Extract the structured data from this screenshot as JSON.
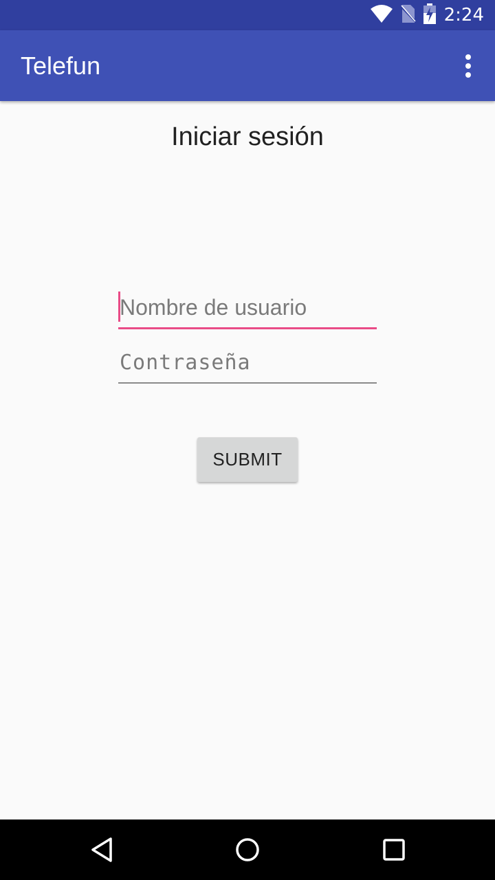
{
  "status_bar": {
    "time": "2:24",
    "icons": [
      "wifi-icon",
      "no-sim-icon",
      "battery-charging-icon"
    ]
  },
  "app_bar": {
    "title": "Telefun",
    "overflow_icon": "more-vert-icon"
  },
  "login": {
    "title": "Iniciar sesión",
    "username_placeholder": "Nombre de usuario",
    "password_placeholder": "Contraseña",
    "submit_label": "SUBMIT"
  },
  "colors": {
    "status_bar": "#303f9f",
    "app_bar": "#3f51b5",
    "accent": "#e94b86",
    "background": "#fafafa",
    "button": "#d6d7d7"
  },
  "nav_bar": {
    "icons": [
      "back-icon",
      "home-icon",
      "recents-icon"
    ]
  }
}
